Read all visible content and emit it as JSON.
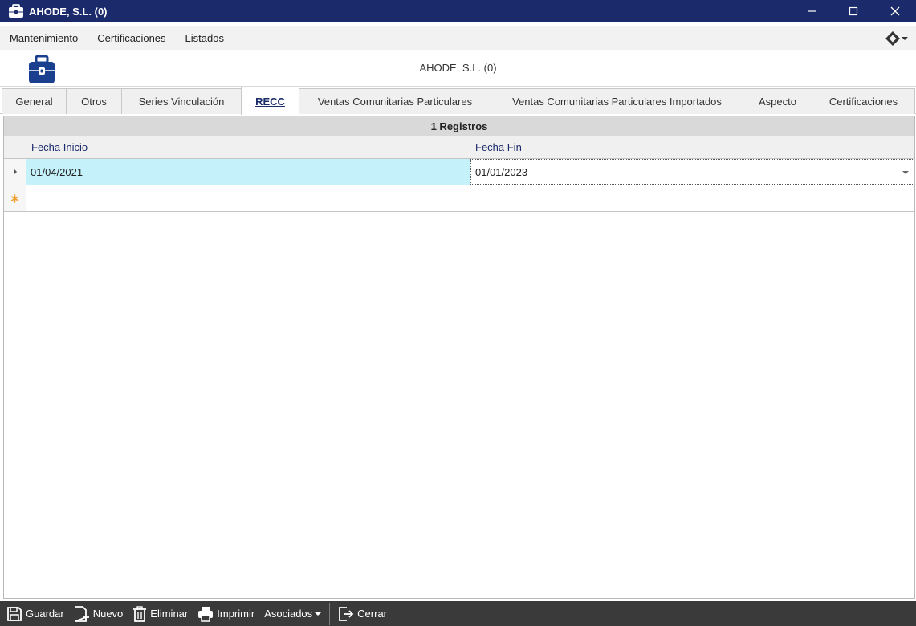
{
  "window": {
    "title": "AHODE, S.L. (0)",
    "minimize": "—",
    "maximize": "☐",
    "close": "✕"
  },
  "menu": {
    "items": [
      "Mantenimiento",
      "Certificaciones",
      "Listados"
    ]
  },
  "header": {
    "company": "AHODE, S.L. (0)"
  },
  "tabs": [
    {
      "label": "General",
      "active": false
    },
    {
      "label": "Otros",
      "active": false
    },
    {
      "label": "Series Vinculación",
      "active": false
    },
    {
      "label": "RECC",
      "active": true
    },
    {
      "label": "Ventas Comunitarias Particulares",
      "active": false
    },
    {
      "label": "Ventas Comunitarias Particulares Importados",
      "active": false
    },
    {
      "label": "Aspecto",
      "active": false
    },
    {
      "label": "Certificaciones",
      "active": false
    }
  ],
  "grid": {
    "caption": "1 Registros",
    "columns": [
      "Fecha Inicio",
      "Fecha Fin"
    ],
    "rows": [
      {
        "fecha_inicio": "01/04/2021",
        "fecha_fin": "01/01/2023"
      }
    ]
  },
  "toolbar": {
    "guardar": "Guardar",
    "nuevo": "Nuevo",
    "eliminar": "Eliminar",
    "imprimir": "Imprimir",
    "asociados": "Asociados",
    "cerrar": "Cerrar"
  },
  "colors": {
    "titlebar": "#1b2a6b",
    "selected_cell": "#c5f2fa",
    "new_row_marker": "#f0a030",
    "toolbar": "#3a3a3a"
  }
}
